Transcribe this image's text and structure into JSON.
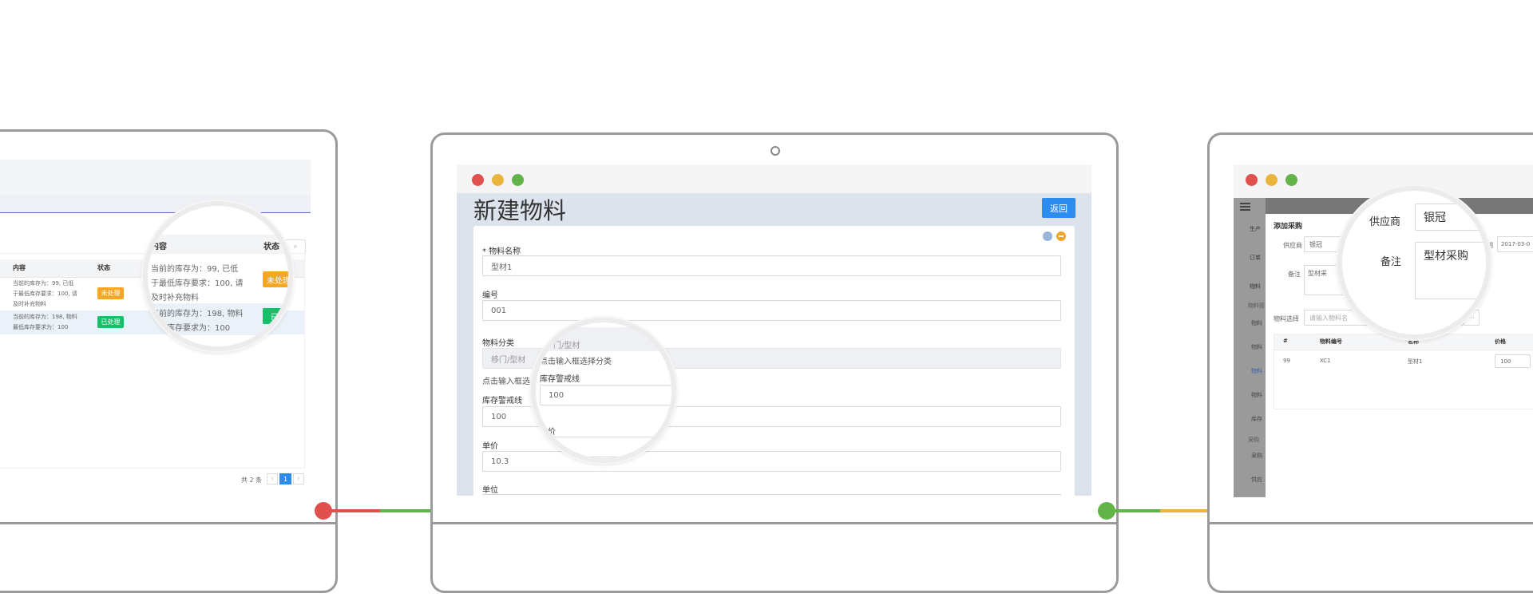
{
  "colors": {
    "red": "#e0504d",
    "yellow": "#eab43c",
    "green": "#62b448",
    "blue": "#2d8cf0",
    "frame": "#9a9a9a"
  },
  "left": {
    "table": {
      "headers": [
        "内容",
        "状态"
      ],
      "rows": [
        {
          "content_lines": [
            "当前的库存为：99, 已低",
            "于最低库存要求：100, 请",
            "及时补充物料"
          ],
          "status": "未处理"
        },
        {
          "content_lines": [
            "当前的库存为：198, 物料",
            "最低库存要求为：100"
          ],
          "status": "已处理"
        }
      ],
      "footer_total": "共 2 条",
      "page": "1",
      "prev": "‹",
      "next": "›",
      "search_icon": "search-icon"
    },
    "magnifier": {
      "headers": [
        "内容",
        "状态"
      ],
      "row1_lines": [
        "当前的库存为：99, 已低",
        "于最低库存要求：100, 请",
        "及时补充物料"
      ],
      "row1_status": "未处理",
      "row2_lines": [
        "当前的库存为：198, 物料",
        "最低库存要求为：100"
      ],
      "row2_status": "已处"
    }
  },
  "center": {
    "title": "新建物料",
    "back_button": "返回",
    "fields": {
      "name_label": "* 物料名称",
      "name_value": "型材1",
      "code_label": "编号",
      "code_value": "001",
      "category_label": "物料分类",
      "category_value": "移门/型材",
      "category_hint": "点击输入框选择分类",
      "warning_label": "库存警戒线",
      "warning_value": "100",
      "price_label": "单价",
      "price_value": "10.3",
      "unit_label": "单位"
    },
    "magnifier": {
      "category_value": "门/型材",
      "hint": "点击输入框选择分类",
      "warning_label": "库存警戒线",
      "warning_value": "100",
      "price_label": "单价",
      "price_partial": "3"
    }
  },
  "right": {
    "sidebar": {
      "items": [
        "生产",
        "订单",
        "物料"
      ],
      "sub_header": "物料管",
      "sub_items": [
        "物料",
        "物料",
        "物料",
        "物料",
        "库存"
      ],
      "group2": "采购",
      "group2_items": [
        "采购",
        "供应"
      ]
    },
    "modal": {
      "title": "添加采购",
      "supplier_label": "供应商",
      "supplier_value": "银冠",
      "date_label": "期",
      "date_value": "2017-03-0",
      "remark_label": "备注",
      "remark_value": "型材采",
      "material_label": "物料选择",
      "material_placeholder": "请输入物料名",
      "more": "···",
      "table_headers": [
        "#",
        "物料编号",
        "名称",
        "价格"
      ],
      "table_row": {
        "id": "99",
        "code": "XC1",
        "name": "型材1",
        "price": "100"
      }
    },
    "magnifier": {
      "supplier_label": "供应商",
      "supplier_value": "银冠",
      "remark_label": "备注",
      "remark_value": "型材采购"
    }
  }
}
